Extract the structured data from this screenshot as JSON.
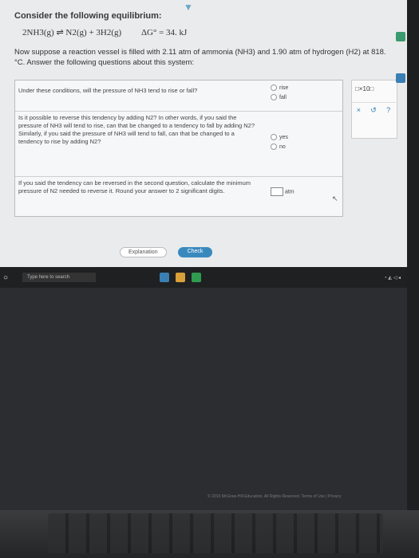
{
  "page": {
    "title": "Consider the following equilibrium:",
    "equation_lhs": "2NH3(g) ⇌ N2(g) + 3H2(g)",
    "equation_dg": "ΔG° = 34. kJ",
    "prompt": "Now suppose a reaction vessel is filled with 2.11 atm of ammonia (NH3) and 1.90 atm of hydrogen (H2) at 818. °C. Answer the following questions about this system:"
  },
  "questions": [
    {
      "text": "Under these conditions, will the pressure of NH3 tend to rise or fall?",
      "options": [
        "rise",
        "fall"
      ]
    },
    {
      "text": "Is it possible to reverse this tendency by adding N2? In other words, if you said the pressure of NH3 will tend to rise, can that be changed to a tendency to fall by adding N2? Similarly, if you said the pressure of NH3 will tend to fall, can that be changed to a tendency to rise by adding N2?",
      "options": [
        "yes",
        "no"
      ]
    },
    {
      "text": "If you said the tendency can be reversed in the second question, calculate the minimum pressure of N2 needed to reverse it. Round your answer to 2 significant digits.",
      "unit": "atm"
    }
  ],
  "side_panel": {
    "box_label": "□×10□",
    "buttons": [
      "×",
      "↺",
      "?"
    ]
  },
  "actions": {
    "explanation": "Explanation",
    "check": "Check"
  },
  "taskbar": {
    "search_placeholder": "Type here to search"
  },
  "footer": "© 2019 McGraw-Hill Education. All Rights Reserved. Terms of Use | Privacy"
}
